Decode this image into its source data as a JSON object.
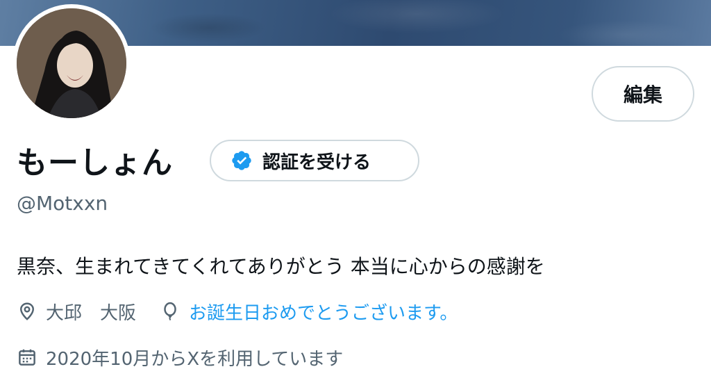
{
  "profile": {
    "display_name": "もーしょん",
    "handle": "@Motxxn",
    "bio": "黒奈、生まれてきてくれてありがとう 本当に心からの感謝を",
    "location": "大邱　大阪",
    "birthday_text": "お誕生日おめでとうございます。",
    "joined": "2020年10月からXを利用しています"
  },
  "actions": {
    "edit_label": "編集",
    "verify_label": "認証を受ける"
  },
  "icons": {
    "location": "location-pin-icon",
    "birthday": "balloon-icon",
    "joined": "calendar-icon",
    "verified": "verified-badge-icon"
  },
  "colors": {
    "link": "#1d9bf0",
    "verified": "#1d9bf0",
    "secondary_text": "#536471",
    "border": "#cfd9de"
  }
}
